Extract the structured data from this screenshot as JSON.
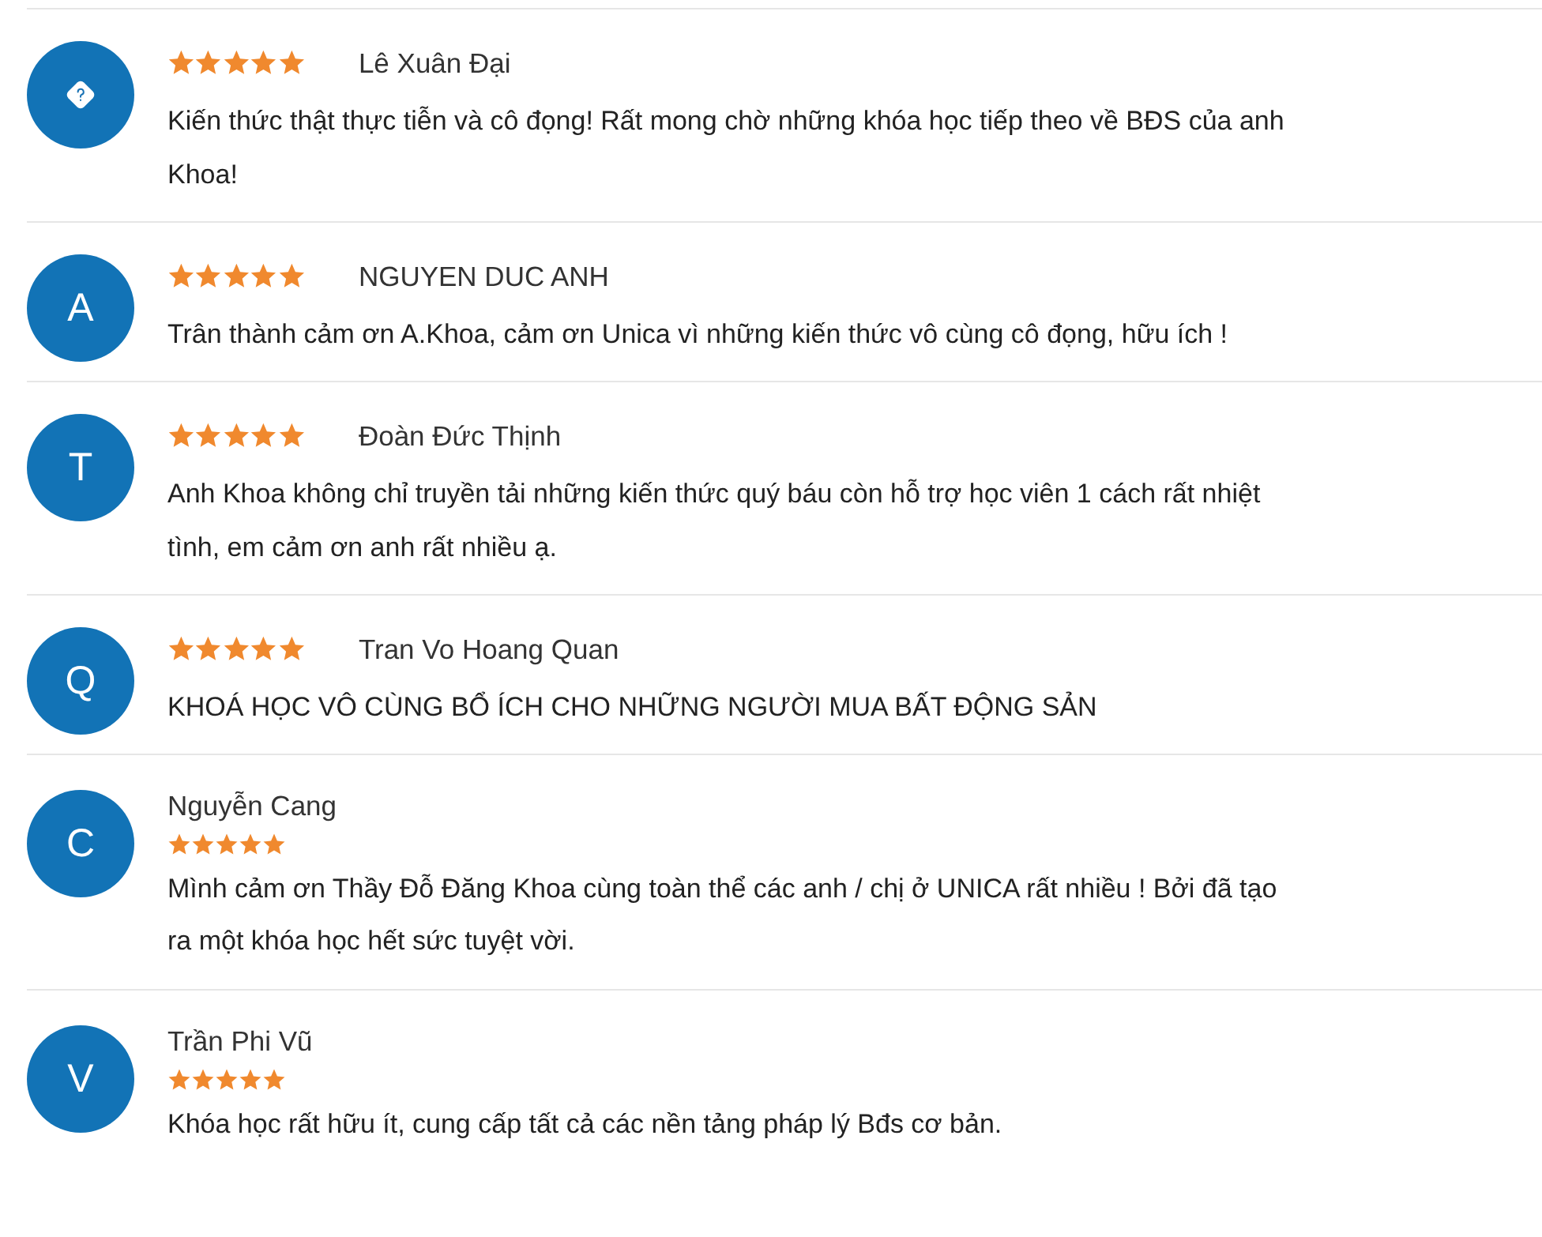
{
  "reviews": [
    {
      "kind": "inline",
      "avatar": {
        "kind": "icon"
      },
      "name": "Lê Xuân Đại",
      "stars": 5,
      "comment": "Kiến thức thật thực tiễn và cô đọng! Rất mong chờ những khóa học tiếp theo về BĐS của anh Khoa!"
    },
    {
      "kind": "inline",
      "avatar": {
        "kind": "letter",
        "letter": "A"
      },
      "name": "NGUYEN DUC ANH",
      "stars": 5,
      "comment": "Trân thành cảm ơn A.Khoa, cảm ơn Unica vì những kiến thức vô cùng cô đọng, hữu ích !"
    },
    {
      "kind": "inline",
      "avatar": {
        "kind": "letter",
        "letter": "T"
      },
      "name": "Đoàn Đức Thịnh",
      "stars": 5,
      "comment": "Anh Khoa không chỉ truyền tải những kiến thức quý báu còn hỗ trợ học viên 1 cách rất nhiệt tình, em cảm ơn anh rất nhiều ạ."
    },
    {
      "kind": "inline",
      "avatar": {
        "kind": "letter",
        "letter": "Q"
      },
      "name": "Tran Vo Hoang Quan",
      "stars": 5,
      "comment": "KHOÁ HỌC VÔ CÙNG BỔ ÍCH CHO NHỮNG NGƯỜI MUA BẤT ĐỘNG SẢN"
    },
    {
      "kind": "stacked",
      "avatar": {
        "kind": "letter",
        "letter": "C"
      },
      "name": "Nguyễn Cang",
      "stars": 5,
      "comment": "Mình cảm ơn Thầy Đỗ Đăng Khoa cùng toàn thể các anh / chị ở UNICA rất nhiều ! Bởi đã tạo ra một khóa học hết sức tuyệt vời."
    },
    {
      "kind": "stacked",
      "avatar": {
        "kind": "letter",
        "letter": "V"
      },
      "name": "Trần Phi Vũ",
      "stars": 5,
      "comment": "Khóa học rất hữu ít, cung cấp tất cả các nền tảng pháp lý Bđs cơ bản."
    }
  ]
}
